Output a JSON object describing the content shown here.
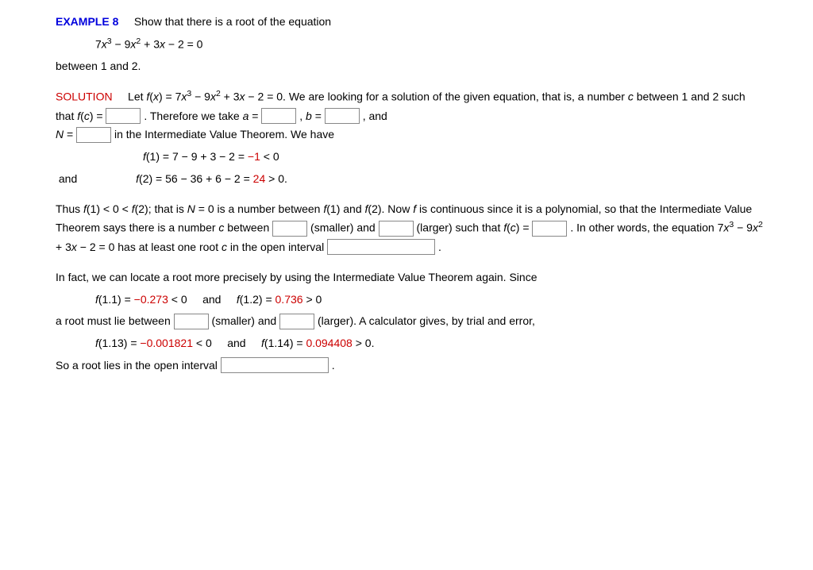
{
  "header": {
    "example_label": "EXAMPLE 8",
    "prompt_lead": "Show that there is a root of the equation",
    "between_text": "between 1 and 2."
  },
  "solution": {
    "label": "SOLUTION",
    "sent1_a": "Let  ",
    "sent1_c": " = 0.  We are looking for a solution of the given equation, that is, a number ",
    "sent1_d": " between 1 and 2 such that  ",
    "sent1_e": " = ",
    "sent1_f": ".  Therefore we take  ",
    "sent1_g": " = ",
    "sent1_h": ",   ",
    "sent1_i": " = ",
    "sent1_j": ",   and ",
    "sent1_k": " = ",
    "sent1_l": "  in the Intermediate Value Theorem. We have"
  },
  "calc": {
    "f1_lhs": "f",
    "f1_arg": "(1)  =  7 − 9 + 3 − 2 = ",
    "f1_val": "−1",
    "f1_tail": " < 0",
    "and_text": "and",
    "f2_lhs": "f",
    "f2_arg": "(2)  =  56 − 36 + 6 − 2 = ",
    "f2_val": "24",
    "f2_tail": " > 0."
  },
  "para2": {
    "a": "Thus  ",
    "b": "(1) < 0 < ",
    "c": "(2);  that is ",
    "d": " = 0 is a number between  ",
    "e": "(1)  and  ",
    "f": "(2).  Now ",
    "g": " is continuous since it is a polynomial, so that the Intermediate Value Theorem says there is a number ",
    "h": " between ",
    "i": " (smaller) and ",
    "j": " (larger) such that  ",
    "k": " = ",
    "l": ".  In other words, the equation  ",
    "m": " = 0  has at least one root ",
    "n": " in the open interval ",
    "o": "."
  },
  "para3": {
    "a": "In fact, we can locate a root more precisely by using the Intermediate Value Theorem again. Since",
    "f11_lhs": "f",
    "f11": "(1.1) = ",
    "f11_val": "−0.273",
    "f11_tail": " < 0",
    "and1": "and",
    "f12_lhs": "f",
    "f12": "(1.2) = ",
    "f12_val": "0.736",
    "f12_tail": " > 0",
    "b": "a root must lie between ",
    "c": " (smaller) and ",
    "d": " (larger). A calculator gives, by trial and error,",
    "f113_lhs": "f",
    "f113": "(1.13) = ",
    "f113_val": "−0.001821",
    "f113_tail": " < 0",
    "and2": "and",
    "f114_lhs": "f",
    "f114": "(1.14) = ",
    "f114_val": "0.094408",
    "f114_tail": " > 0.",
    "e": "So a root lies in the open interval ",
    "f": "."
  },
  "math": {
    "fx": "f(x)",
    "fc": "f(c)",
    "f": "f",
    "c": "c",
    "a": "a",
    "b": "b",
    "N": "N"
  }
}
